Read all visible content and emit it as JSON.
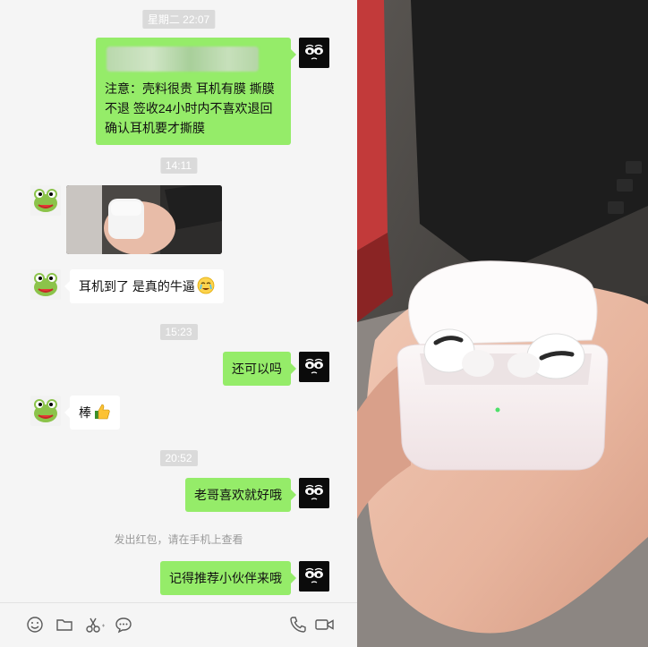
{
  "chat": {
    "messages": [
      {
        "type": "time",
        "text": "星期二 22:07"
      },
      {
        "type": "sent",
        "lines": [
          "注意：壳料很贵 耳机有膜 撕膜",
          "不退 签收24小时内不喜欢退回",
          "确认耳机要才撕膜"
        ]
      },
      {
        "type": "time",
        "text": "14:11"
      },
      {
        "type": "received-image"
      },
      {
        "type": "received",
        "text": "耳机到了 是真的牛逼"
      },
      {
        "type": "time",
        "text": "15:23"
      },
      {
        "type": "sent",
        "text": "还可以吗"
      },
      {
        "type": "received",
        "text": "棒"
      },
      {
        "type": "time",
        "text": "20:52"
      },
      {
        "type": "sent",
        "text": "老哥喜欢就好哦"
      },
      {
        "type": "system",
        "text": "发出红包，请在手机上查看"
      },
      {
        "type": "sent",
        "text": "记得推荐小伙伴来哦"
      }
    ]
  },
  "toolbar": {
    "left_icons": [
      "smile-icon",
      "folder-icon",
      "scissors-icon",
      "chat-bubble-icon"
    ],
    "right_icons": [
      "phone-icon",
      "video-icon"
    ]
  },
  "colors": {
    "sent_bubble": "#95ec69",
    "received_bubble": "#ffffff",
    "background": "#f5f5f5",
    "timestamp_bg": "#dadada"
  }
}
